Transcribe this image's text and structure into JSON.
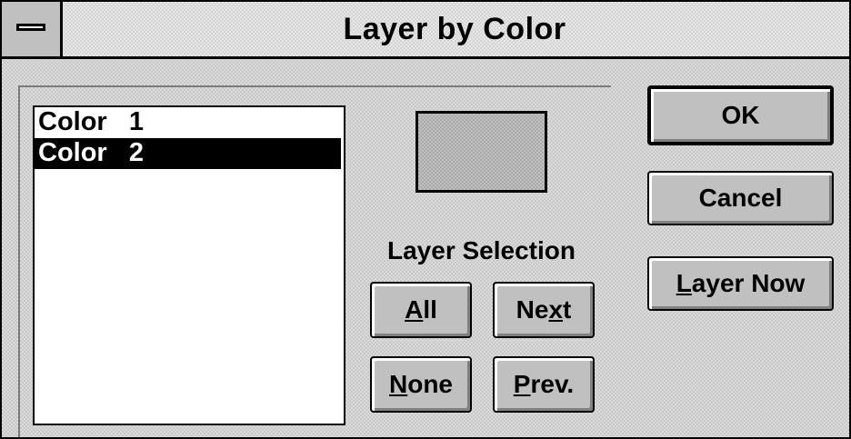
{
  "window": {
    "title": "Layer by Color"
  },
  "color_list": {
    "items": [
      {
        "label": "Color   1",
        "selected": false
      },
      {
        "label": "Color   2",
        "selected": true
      }
    ]
  },
  "preview": {
    "swatch_color": "#c0c0c0"
  },
  "layer_selection": {
    "label": "Layer Selection",
    "all": {
      "pre": "",
      "accel": "A",
      "post": "ll"
    },
    "next": {
      "pre": "Ne",
      "accel": "x",
      "post": "t"
    },
    "none": {
      "pre": "",
      "accel": "N",
      "post": "one"
    },
    "prev": {
      "pre": "",
      "accel": "P",
      "post": "rev."
    }
  },
  "actions": {
    "ok": "OK",
    "cancel": "Cancel",
    "layer_now": {
      "pre": "",
      "accel": "L",
      "post": "ayer Now"
    }
  },
  "colors": {
    "dialog_face": "#c0c0c0",
    "selection_bg": "#000000",
    "selection_fg": "#ffffff"
  }
}
